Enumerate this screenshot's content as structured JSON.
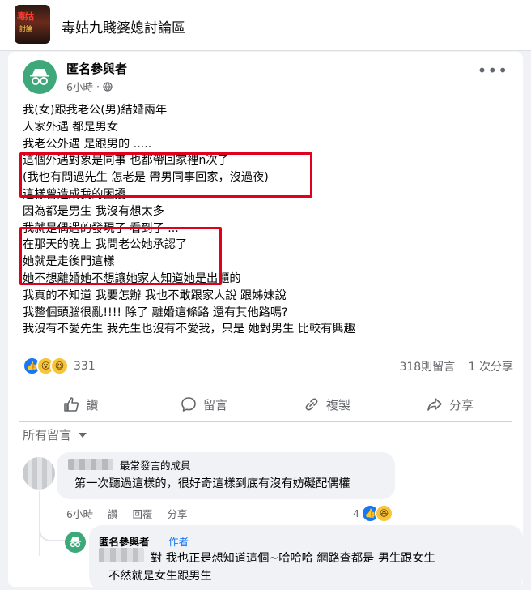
{
  "group": {
    "thumb_text_1": "毒姑",
    "thumb_text_2": "討論",
    "name": "毒姑九賤婆媳討論區"
  },
  "post": {
    "author": "匿名參與者",
    "time": "6小時",
    "more": "•••",
    "lines": [
      "我(女)跟我老公(男)結婚兩年",
      "人家外遇 都是男女",
      "我老公外遇 是跟男的 .....",
      "這個外遇對象是同事 也都帶回家裡n次了",
      "(我也有問過先生 怎老是 帶男同事回家，沒過夜)",
      "這樣曾造成我的困擾",
      "因為都是男生 我沒有想太多",
      "我就是偶遇的發現了 看到了 ...",
      "在那天的晚上 我問老公她承認了",
      "她就是走後門這樣",
      "她不想離婚她不想讓她家人知道她是出櫃的",
      "我真的不知道 我要怎辦 我也不敢跟家人說 跟姊妹說",
      "我整個頭腦很亂!!!!  除了 離婚這條路 還有其他路嗎?",
      "我沒有不愛先生 我先生也沒有不愛我，只是 她對男生 比較有興趣"
    ],
    "reaction_count": "331",
    "comment_count": "318則留言",
    "share_count": "1 次分享",
    "actions": {
      "like": "讚",
      "comment": "留言",
      "copy": "複製",
      "share": "分享"
    }
  },
  "comments": {
    "filter_label": "所有留言",
    "first": {
      "badge": "最常發言的成員",
      "text": "第一次聽過這樣的，很好奇這樣到底有沒有妨礙配偶權",
      "time": "6小時",
      "like": "讚",
      "reply": "回覆",
      "share": "分享",
      "reaction_count": "4"
    },
    "reply": {
      "author": "匿名參與者",
      "author_badge": "作者",
      "line1": "對 我也正是想知道這個~哈哈哈 網路查都是 男生跟女生",
      "line2": "不然就是女生跟男生"
    }
  },
  "colors": {
    "brand_blue": "#1877f2",
    "anon_green": "#3ea87b",
    "highlight_red": "#e0001b"
  }
}
